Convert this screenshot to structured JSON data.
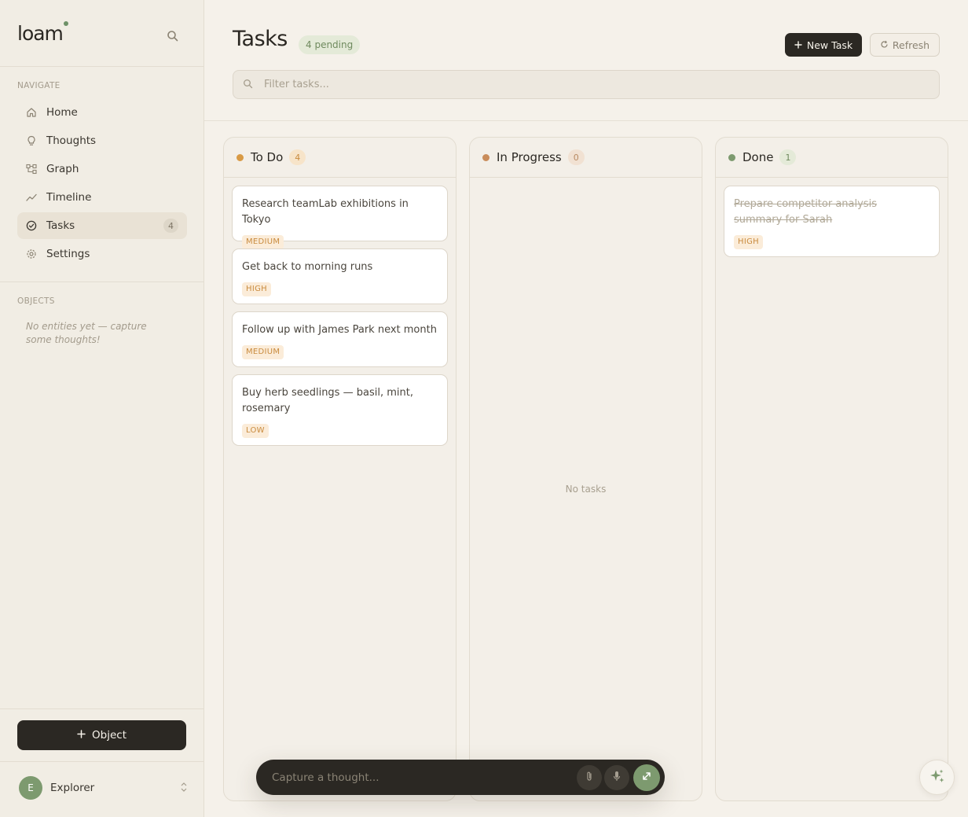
{
  "app": {
    "brand": "loam"
  },
  "sidebar": {
    "navigate_heading": "NAVIGATE",
    "items": [
      {
        "label": "Home",
        "icon": "home-icon"
      },
      {
        "label": "Thoughts",
        "icon": "lightbulb-icon"
      },
      {
        "label": "Graph",
        "icon": "graph-icon"
      },
      {
        "label": "Timeline",
        "icon": "timeline-icon"
      },
      {
        "label": "Tasks",
        "icon": "check-circle-icon",
        "badge": "4",
        "active": true
      },
      {
        "label": "Settings",
        "icon": "gear-icon"
      }
    ],
    "objects_heading": "OBJECTS",
    "objects_empty": "No entities yet — capture some thoughts!",
    "object_button": "Object",
    "user": {
      "initial": "E",
      "name": "Explorer"
    }
  },
  "header": {
    "title": "Tasks",
    "pending_badge": "4 pending",
    "new_task_label": "New Task",
    "refresh_label": "Refresh",
    "filter_placeholder": "Filter tasks..."
  },
  "board": {
    "columns": [
      {
        "title": "To Do",
        "count": "4",
        "dot_color": "#d89a45",
        "tasks": [
          {
            "text": "Research teamLab exhibitions in Tokyo",
            "priority": "MEDIUM"
          },
          {
            "text": "Get back to morning runs",
            "priority": "HIGH"
          },
          {
            "text": "Follow up with James Park next month",
            "priority": "MEDIUM"
          },
          {
            "text": "Buy herb seedlings — basil, mint, rosemary",
            "priority": "LOW"
          }
        ]
      },
      {
        "title": "In Progress",
        "count": "0",
        "dot_color": "#c98c5a",
        "empty_text": "No tasks",
        "tasks": []
      },
      {
        "title": "Done",
        "count": "1",
        "dot_color": "#7d9a6f",
        "tasks": [
          {
            "text": "Prepare competitor analysis summary for Sarah",
            "priority": "HIGH",
            "done": true
          }
        ]
      }
    ]
  },
  "capture": {
    "placeholder": "Capture a thought..."
  },
  "colors": {
    "accent_green": "#7d9a6f",
    "dark": "#2b2823",
    "background": "#f5f1ea"
  }
}
